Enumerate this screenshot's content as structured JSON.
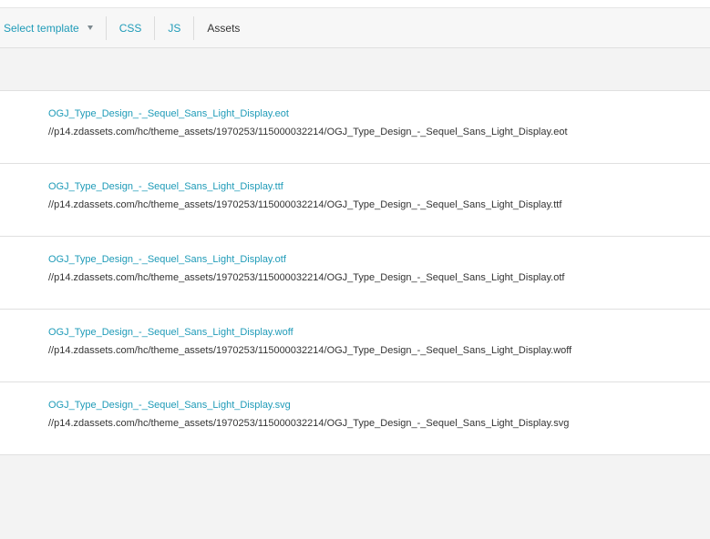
{
  "toolbar": {
    "template_select_label": "Select template",
    "tab_css": "CSS",
    "tab_js": "JS",
    "tab_assets": "Assets"
  },
  "assets": [
    {
      "name": "OGJ_Type_Design_-_Sequel_Sans_Light_Display.eot",
      "url": "//p14.zdassets.com/hc/theme_assets/1970253/115000032214/OGJ_Type_Design_-_Sequel_Sans_Light_Display.eot"
    },
    {
      "name": "OGJ_Type_Design_-_Sequel_Sans_Light_Display.ttf",
      "url": "//p14.zdassets.com/hc/theme_assets/1970253/115000032214/OGJ_Type_Design_-_Sequel_Sans_Light_Display.ttf"
    },
    {
      "name": "OGJ_Type_Design_-_Sequel_Sans_Light_Display.otf",
      "url": "//p14.zdassets.com/hc/theme_assets/1970253/115000032214/OGJ_Type_Design_-_Sequel_Sans_Light_Display.otf"
    },
    {
      "name": "OGJ_Type_Design_-_Sequel_Sans_Light_Display.woff",
      "url": "//p14.zdassets.com/hc/theme_assets/1970253/115000032214/OGJ_Type_Design_-_Sequel_Sans_Light_Display.woff"
    },
    {
      "name": "OGJ_Type_Design_-_Sequel_Sans_Light_Display.svg",
      "url": "//p14.zdassets.com/hc/theme_assets/1970253/115000032214/OGJ_Type_Design_-_Sequel_Sans_Light_Display.svg"
    }
  ],
  "colors": {
    "link": "#1f9bb8",
    "text": "#333333",
    "background": "#f3f3f3",
    "divider": "#e0e0e0"
  },
  "icons": {
    "template_dropdown": "chevron-down-icon"
  }
}
